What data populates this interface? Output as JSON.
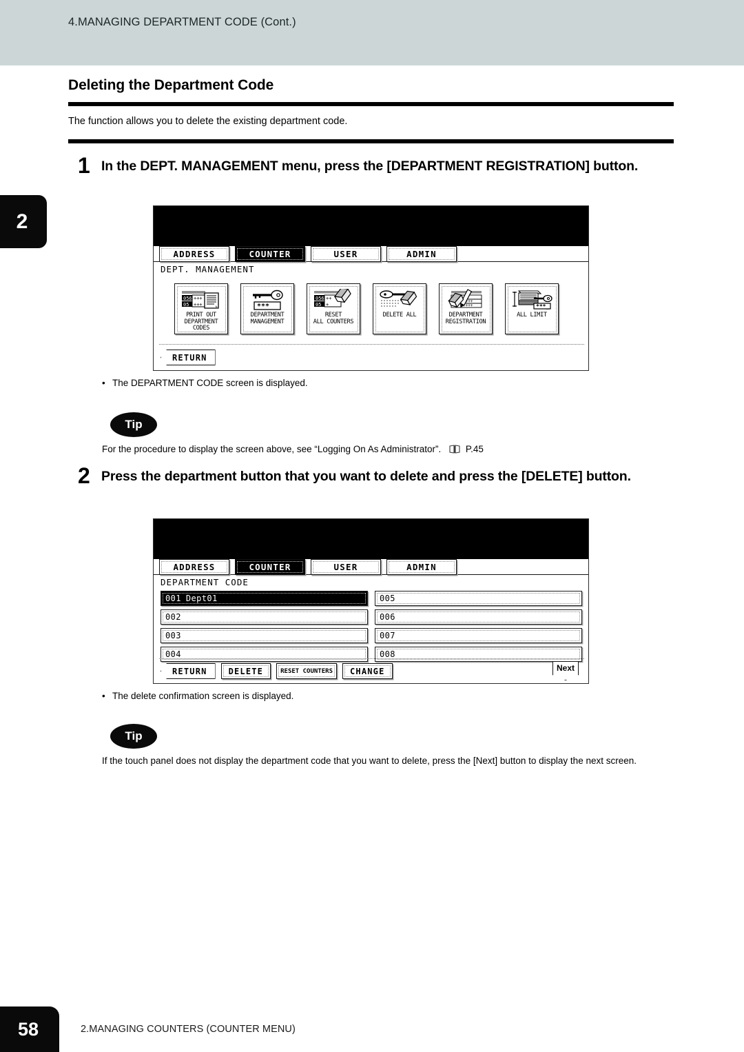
{
  "header": {
    "title": "4.MANAGING DEPARTMENT CODE (Cont.)"
  },
  "chapter_tab": {
    "number": "2"
  },
  "section": {
    "title": "Deleting the Department Code",
    "intro": "The function allows you to delete the existing department code."
  },
  "steps": [
    {
      "number": "1",
      "text": "In the DEPT. MANAGEMENT menu, press the [DEPARTMENT REGISTRATION] button.",
      "caption": "The DEPARTMENT CODE screen is displayed.",
      "tip_label": "Tip",
      "tip_text": "For the procedure to display the screen above, see “Logging On As Administrator”.",
      "tip_ref": "P.45"
    },
    {
      "number": "2",
      "text": "Press the department button that you want to delete and press the [DELETE] button.",
      "caption": "The delete confirmation screen is displayed.",
      "tip_label": "Tip",
      "tip_text": "If the touch panel does not display the department code that you want to delete, press the [Next] button to display the next screen."
    }
  ],
  "lcd1": {
    "tabs": [
      {
        "label": "ADDRESS",
        "selected": false
      },
      {
        "label": "COUNTER",
        "selected": true
      },
      {
        "label": "USER",
        "selected": false
      },
      {
        "label": "ADMIN",
        "selected": false
      }
    ],
    "screen_label": "DEPT. MANAGEMENT",
    "icons": [
      {
        "name": "print-out-department-codes-icon",
        "line1": "PRINT OUT",
        "line2": "DEPARTMENT CODES"
      },
      {
        "name": "department-management-icon",
        "line1": "DEPARTMENT",
        "line2": "MANAGEMENT"
      },
      {
        "name": "reset-all-counters-icon",
        "line1": "RESET",
        "line2": "ALL COUNTERS"
      },
      {
        "name": "delete-all-icon",
        "line1": "DELETE ALL",
        "line2": ""
      },
      {
        "name": "department-registration-icon",
        "line1": "DEPARTMENT",
        "line2": "REGISTRATION"
      },
      {
        "name": "all-limit-icon",
        "line1": "ALL LIMIT",
        "line2": ""
      }
    ],
    "return_button": "RETURN"
  },
  "lcd2": {
    "tabs": [
      {
        "label": "ADDRESS",
        "selected": false
      },
      {
        "label": "COUNTER",
        "selected": true
      },
      {
        "label": "USER",
        "selected": false
      },
      {
        "label": "ADMIN",
        "selected": false
      }
    ],
    "screen_label": "DEPARTMENT CODE",
    "departments": [
      {
        "code": "001",
        "name": "Dept01",
        "selected": true
      },
      {
        "code": "005",
        "name": "",
        "selected": false
      },
      {
        "code": "002",
        "name": "",
        "selected": false
      },
      {
        "code": "006",
        "name": "",
        "selected": false
      },
      {
        "code": "003",
        "name": "",
        "selected": false
      },
      {
        "code": "007",
        "name": "",
        "selected": false
      },
      {
        "code": "004",
        "name": "",
        "selected": false
      },
      {
        "code": "008",
        "name": "",
        "selected": false
      }
    ],
    "buttons": {
      "return": "RETURN",
      "delete": "DELETE",
      "reset_counters": "RESET COUNTERS",
      "change": "CHANGE",
      "next": "Next"
    }
  },
  "footer": {
    "page_number": "58",
    "text": "2.MANAGING COUNTERS (COUNTER MENU)"
  }
}
